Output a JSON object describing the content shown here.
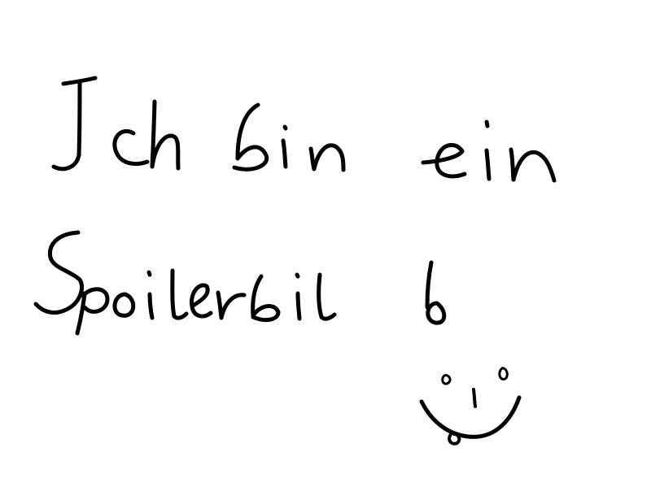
{
  "handwriting": {
    "line1": "Ich bin ein",
    "line2": "Spoilerbild",
    "has_smiley": true
  },
  "colors": {
    "background": "#ffffff",
    "ink": "#000000"
  }
}
